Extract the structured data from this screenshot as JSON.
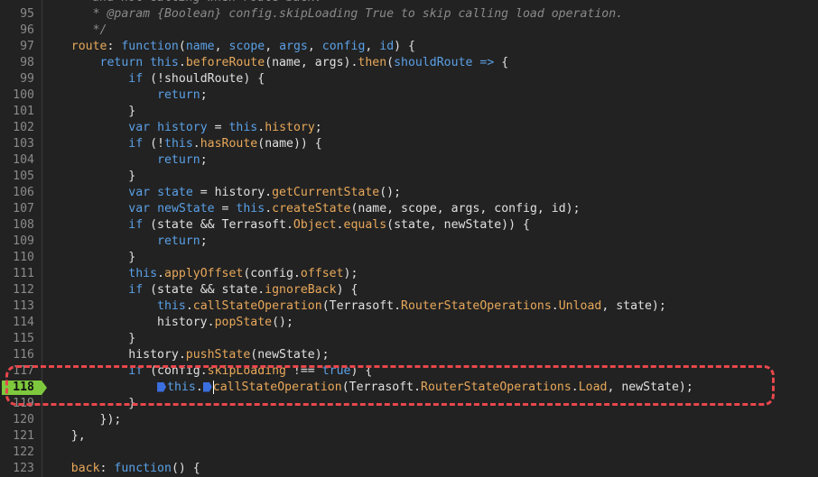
{
  "editor": {
    "lines": [
      {
        "n": "95",
        "html": "<span class=\"c\">       * @param {Boolean} config.skipLoading True to skip calling load operation.</span>"
      },
      {
        "n": "96",
        "html": "<span class=\"c\">       */</span>"
      },
      {
        "n": "97",
        "html": "<span class=\"f\">    route</span><span class=\"p\">: </span><span class=\"k\">function</span><span class=\"p\">(</span><span class=\"k\">name</span><span class=\"p\">, </span><span class=\"k\">scope</span><span class=\"p\">, </span><span class=\"k\">args</span><span class=\"p\">, </span><span class=\"k\">config</span><span class=\"p\">, </span><span class=\"k\">id</span><span class=\"p\">) {</span>"
      },
      {
        "n": "98",
        "html": "<span class=\"p\">        </span><span class=\"k\">return this</span><span class=\"p\">.</span><span class=\"f\">beforeRoute</span><span class=\"p\">(name, args).</span><span class=\"f\">then</span><span class=\"p\">(</span><span class=\"k\">shouldRoute</span><span class=\"p\"> </span><span class=\"k\">=&gt;</span><span class=\"p\"> {</span>"
      },
      {
        "n": "99",
        "html": "<span class=\"p\">            </span><span class=\"k\">if</span><span class=\"p\"> (!shouldRoute) {</span>"
      },
      {
        "n": "100",
        "html": "<span class=\"p\">                </span><span class=\"k\">return</span><span class=\"p\">;</span>"
      },
      {
        "n": "101",
        "html": "<span class=\"p\">            }</span>"
      },
      {
        "n": "102",
        "html": "<span class=\"p\">            </span><span class=\"k\">var</span><span class=\"p\"> </span><span class=\"k\">history</span><span class=\"p\"> = </span><span class=\"k\">this</span><span class=\"p\">.</span><span class=\"f\">history</span><span class=\"p\">;</span>"
      },
      {
        "n": "103",
        "html": "<span class=\"p\">            </span><span class=\"k\">if</span><span class=\"p\"> (!</span><span class=\"k\">this</span><span class=\"p\">.</span><span class=\"f\">hasRoute</span><span class=\"p\">(name)) {</span>"
      },
      {
        "n": "104",
        "html": "<span class=\"p\">                </span><span class=\"k\">return</span><span class=\"p\">;</span>"
      },
      {
        "n": "105",
        "html": "<span class=\"p\">            }</span>"
      },
      {
        "n": "106",
        "html": "<span class=\"p\">            </span><span class=\"k\">var</span><span class=\"p\"> </span><span class=\"k\">state</span><span class=\"p\"> = history.</span><span class=\"f\">getCurrentState</span><span class=\"p\">();</span>"
      },
      {
        "n": "107",
        "html": "<span class=\"p\">            </span><span class=\"k\">var</span><span class=\"p\"> </span><span class=\"k\">newState</span><span class=\"p\"> = </span><span class=\"k\">this</span><span class=\"p\">.</span><span class=\"f\">createState</span><span class=\"p\">(name, scope, args, config, id);</span>"
      },
      {
        "n": "108",
        "html": "<span class=\"p\">            </span><span class=\"k\">if</span><span class=\"p\"> (state &amp;&amp; Terrasoft.</span><span class=\"f\">Object</span><span class=\"p\">.</span><span class=\"f\">equals</span><span class=\"p\">(state, newState)) {</span>"
      },
      {
        "n": "109",
        "html": "<span class=\"p\">                </span><span class=\"k\">return</span><span class=\"p\">;</span>"
      },
      {
        "n": "110",
        "html": "<span class=\"p\">            }</span>"
      },
      {
        "n": "111",
        "html": "<span class=\"p\">            </span><span class=\"k\">this</span><span class=\"p\">.</span><span class=\"f\">applyOffset</span><span class=\"p\">(config.</span><span class=\"f\">offset</span><span class=\"p\">);</span>"
      },
      {
        "n": "112",
        "html": "<span class=\"p\">            </span><span class=\"k\">if</span><span class=\"p\"> (state &amp;&amp; state.</span><span class=\"f\">ignoreBack</span><span class=\"p\">) {</span>"
      },
      {
        "n": "113",
        "html": "<span class=\"p\">                </span><span class=\"k\">this</span><span class=\"p\">.</span><span class=\"f\">callStateOperation</span><span class=\"p\">(Terrasoft.</span><span class=\"f\">RouterStateOperations</span><span class=\"p\">.</span><span class=\"f\">Unload</span><span class=\"p\">, state);</span>"
      },
      {
        "n": "114",
        "html": "<span class=\"p\">                history.</span><span class=\"f\">popState</span><span class=\"p\">();</span>"
      },
      {
        "n": "115",
        "html": "<span class=\"p\">            }</span>"
      },
      {
        "n": "116",
        "html": "<span class=\"p\">            history.</span><span class=\"f\">pushState</span><span class=\"p\">(newState);</span>"
      },
      {
        "n": "117",
        "html": "<span class=\"p\">            </span><span class=\"k\">if</span><span class=\"p\"> (config.</span><span class=\"f\">skipLoading</span><span class=\"p\"> !== </span><span class=\"k\">true</span><span class=\"p\">) {</span>"
      },
      {
        "n": "118",
        "html": "<span class=\"p\">                </span><span class=\"step\" data-name=\"step-marker-icon\" data-interactable=\"false\"></span><span class=\"k\">this</span><span class=\"p\">.</span><span class=\"step\" data-name=\"step-marker-icon\" data-interactable=\"false\"></span><span class=\"cursor\" data-name=\"text-cursor\" data-interactable=\"false\"></span><span class=\"f\">callStateOperation</span><span class=\"p\">(Terrasoft.</span><span class=\"f\">RouterStateOperations</span><span class=\"p\">.</span><span class=\"f\">Load</span><span class=\"p\">, newState);</span>"
      },
      {
        "n": "119",
        "html": "<span class=\"p\">            }</span>"
      },
      {
        "n": "120",
        "html": "<span class=\"p\">        });</span>"
      },
      {
        "n": "121",
        "html": "<span class=\"p\">    },</span>"
      },
      {
        "n": "122",
        "html": ""
      },
      {
        "n": "123",
        "html": "<span class=\"f\">    back</span><span class=\"p\">: </span><span class=\"k\">function</span><span class=\"p\">() {</span>"
      }
    ],
    "top_partial": "       and not calling when route back.",
    "breakpoint_line": "118"
  }
}
